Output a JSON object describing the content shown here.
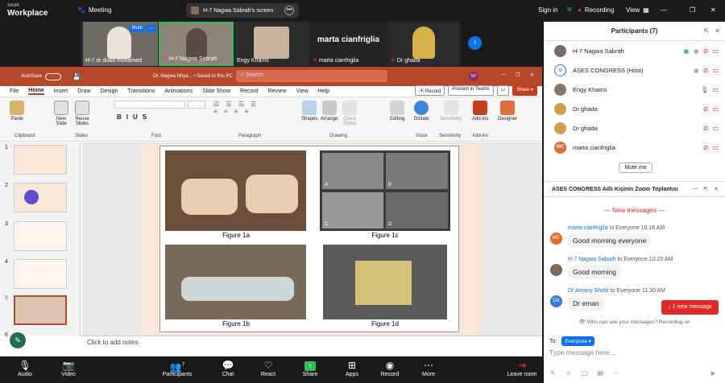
{
  "topbar": {
    "logo_top": "zoom",
    "logo_bottom": "Workplace",
    "meeting": "Meeting",
    "share_title": "H-7 Nagwa Sabrah's screen",
    "signin": "Sign in",
    "recording": "Recording",
    "view": "View"
  },
  "thumbs": [
    {
      "name": "H-7 dr doaa mohamed",
      "mute_btn": "Mute"
    },
    {
      "name": "H-7 Nagwa Sabrah"
    },
    {
      "name": "Engy Khams"
    },
    {
      "name": "marta cianfriglia",
      "big": "marta cianfriglia"
    },
    {
      "name": "Dr ghada"
    }
  ],
  "ppt": {
    "autosave": "AutoSave",
    "filename": "Dr. Nagwa Nhya... • Saved to this PC",
    "search": "Search",
    "user": "NY",
    "tabs": [
      "File",
      "Home",
      "Insert",
      "Draw",
      "Design",
      "Transitions",
      "Animations",
      "Slide Show",
      "Record",
      "Review",
      "View",
      "Help"
    ],
    "record_btn": "Record",
    "teams_btn": "Present in Teams",
    "share_btn": "Share",
    "ribbon": {
      "paste": "Paste",
      "new_slide": "New Slide",
      "reuse": "Reuse Slides",
      "shapes": "Shapes",
      "arrange": "Arrange",
      "quick": "Quick Styles",
      "editing": "Editing",
      "dictate": "Dictate",
      "sensitivity": "Sensitivity",
      "addins": "Add-ins",
      "designer": "Designer",
      "groups": [
        "Clipboard",
        "Slides",
        "Font",
        "Paragraph",
        "Drawing",
        "Voice",
        "Sensitivity",
        "Add-ins"
      ]
    },
    "slides": [
      "1",
      "2",
      "3",
      "4",
      "5",
      "6"
    ],
    "figures": [
      "Figure 1a",
      "Figure 1c",
      "Figure 1b",
      "Figure 1d"
    ],
    "fig_labels": [
      "A",
      "B",
      "C",
      "D"
    ],
    "notes": "Click to add notes"
  },
  "panel": {
    "title": "Participants (7)",
    "participants": [
      {
        "name": "H-7 Nagwa Sabrah",
        "color": "#7b6a5e"
      },
      {
        "name": "ASES CONGRESS (Host)",
        "color": "#ffffff"
      },
      {
        "name": "Engy Khams",
        "color": "#8a7766"
      },
      {
        "name": "Dr ghada",
        "color": "#c9a24a"
      },
      {
        "name": "Dr ghada",
        "color": "#c9a24a"
      },
      {
        "name": "marta cianfriglia",
        "initials": "MC",
        "color": "#e8692c"
      }
    ],
    "mute_me": "Mute me",
    "chat_title": "ASES CONGRESS Adlı Kişinin Zoom Toplantısı",
    "new_messages": "New messages",
    "messages": [
      {
        "from": "marta cianfriglia",
        "to": "to Everyone",
        "time": "10:16 AM",
        "text": "Good morning everyone",
        "initials": "MC",
        "color": "#e8692c"
      },
      {
        "from": "H-7 Nagwa Sabrah",
        "to": "to Everyone",
        "time": "10:20 AM",
        "text": "Good morning",
        "initials": "",
        "color": "#7b6a5e"
      },
      {
        "from": "Dr Amany Shebl",
        "to": "to Everyone",
        "time": "11:30 AM",
        "text": "Dr eman",
        "initials": "DA",
        "color": "#3a7bd5"
      }
    ],
    "new_message_btn": "1 new message",
    "hint": "Who can see your messages? Recording on",
    "to_label": "To:",
    "to_value": "Everyone",
    "placeholder": "Type message here..."
  },
  "toolbar": {
    "audio": "Audio",
    "video": "Video",
    "participants": "Participants",
    "participants_count": "7",
    "chat": "Chat",
    "react": "React",
    "share": "Share",
    "apps": "Apps",
    "record": "Record",
    "more": "More",
    "leave": "Leave room"
  }
}
